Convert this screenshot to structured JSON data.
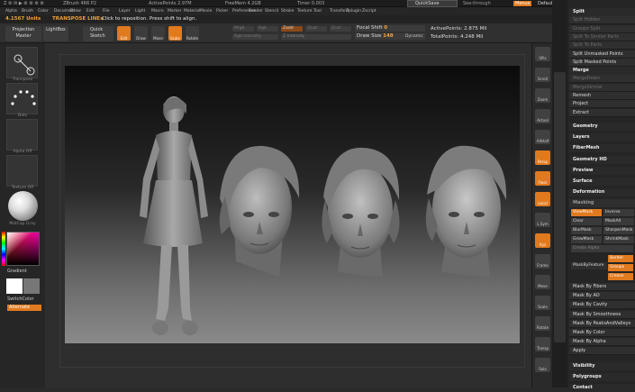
{
  "topbar": {
    "items": [
      "Z ⚙ ✉ ▶ ⚙ ⚙ ⚙ ⚙",
      "ZBrush 4R6 P2",
      "ActivePoints 2.97M",
      "FreeMem 4.2GB",
      "Timer 0.003"
    ],
    "quicksave": "QuickSave",
    "ui_label": "See-through",
    "menus_label": "Menus",
    "default_script": "DefaultZScript"
  },
  "menus": [
    "Alpha",
    "Brush",
    "Color",
    "Document",
    "Draw",
    "Edit",
    "File",
    "Layer",
    "Light",
    "Macro",
    "Marker",
    "Material",
    "Movie",
    "Picker",
    "Preferences",
    "Render",
    "Stencil",
    "Stroke",
    "Texture",
    "Tool",
    "Transform",
    "Zplugin",
    "Zscript"
  ],
  "info": {
    "units": "4.1567 Units",
    "transpose": "TRANSPOSE LINE≥",
    "message": "Click to reposition. Press shift to align."
  },
  "toolbar": {
    "projection_master": "Projection Master",
    "lightbox": "LightBox",
    "quick_sketch": "Quick Sketch",
    "tools": [
      {
        "label": "Edit",
        "active": true
      },
      {
        "label": "Draw",
        "active": false
      },
      {
        "label": "Move",
        "active": false
      },
      {
        "label": "Scale",
        "active": true
      },
      {
        "label": "Rotate",
        "active": false
      }
    ],
    "sliders": [
      "Mrgb",
      "Rgb",
      "M",
      "Zadd",
      "Zsub",
      "Zcut",
      "Rgb Intensity",
      "Z Intensity"
    ],
    "focal_label": "Focal Shift",
    "focal_value": "0",
    "draw_label": "Draw Size",
    "draw_value": "148",
    "dynamic": "Dynamic",
    "active_points": "ActivePoints: 2.875 Mil",
    "total_points": "TotalPoints: 4.248 Mil"
  },
  "left": {
    "brush": "Transpose",
    "stroke": "Dots",
    "alpha": "Alpha Off",
    "texture": "Texture Off",
    "material": "MatCap Gray",
    "gradient": "Gradient",
    "switch_color": "SwitchColor",
    "alternate": "Alternate"
  },
  "shelf": [
    {
      "label": "SPix",
      "active": false
    },
    {
      "label": "Scroll",
      "active": false
    },
    {
      "label": "Zoom",
      "active": false
    },
    {
      "label": "Actual",
      "active": false
    },
    {
      "label": "AAHalf",
      "active": false
    },
    {
      "label": "Persp",
      "active": true
    },
    {
      "label": "Floor",
      "active": true
    },
    {
      "label": "Local",
      "active": true
    },
    {
      "label": "L.Sym",
      "active": false
    },
    {
      "label": "Xyz",
      "active": true
    },
    {
      "label": "Frame",
      "active": false
    },
    {
      "label": "Move",
      "active": false
    },
    {
      "label": "Scale",
      "active": false
    },
    {
      "label": "Rotate",
      "active": false
    },
    {
      "label": "Transp",
      "active": false
    },
    {
      "label": "Solo",
      "active": false
    }
  ],
  "right": {
    "top": [
      {
        "label": "Split",
        "dim": false,
        "head": true
      },
      {
        "label": "Split Hidden",
        "dim": true
      },
      {
        "label": "Groups Split",
        "dim": true
      },
      {
        "label": "Split To Similar Parts",
        "dim": true
      },
      {
        "label": "Split To Parts",
        "dim": true
      },
      {
        "label": "Split Unmasked Points",
        "dim": false
      },
      {
        "label": "Split Masked Points",
        "dim": false
      },
      {
        "label": "Merge",
        "dim": false,
        "head": true
      },
      {
        "label": "MergeDown",
        "dim": true
      },
      {
        "label": "MergeSimilar",
        "dim": true
      },
      {
        "label": "Remesh",
        "dim": false
      },
      {
        "label": "Project",
        "dim": false
      },
      {
        "label": "Extract",
        "dim": false
      }
    ],
    "sections": [
      "Geometry",
      "Layers",
      "FiberMesh",
      "Geometry HD",
      "Preview",
      "Surface",
      "Deformation"
    ],
    "masking_title": "Masking",
    "masking": [
      [
        "ViewMask",
        "Inverse"
      ],
      [
        "Clear",
        "MaskAll"
      ],
      [
        "BlurMask",
        "SharpenMask"
      ],
      [
        "GrowMask",
        "ShrinkMask"
      ]
    ],
    "create_alpha": "Create Alpha",
    "mask_by_feature": "MaskByFeature",
    "border": "Border",
    "groups": "Groups",
    "crease": "Crease",
    "mask_by": [
      "Mask By Fibers",
      "Mask By AO",
      "Mask By Cavity",
      "Mask By Smoothness",
      "Mask By PeaksAndValleys",
      "Mask By Color",
      "Mask By Alpha",
      "Apply"
    ],
    "bottom": [
      "Visibility",
      "Polygroups",
      "Contact"
    ]
  },
  "colors": {
    "accent": "#e07a1f",
    "bg": "#2a2a2a",
    "panel": "#252525"
  }
}
